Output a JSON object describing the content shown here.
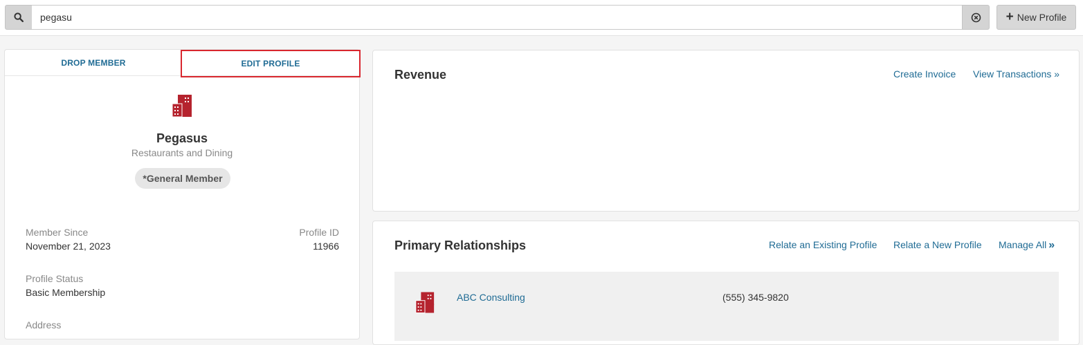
{
  "search": {
    "value": "pegasu",
    "new_profile_label": "New Profile"
  },
  "profile": {
    "tabs": {
      "drop_member": "DROP MEMBER",
      "edit_profile": "EDIT PROFILE"
    },
    "name": "Pegasus",
    "category": "Restaurants and Dining",
    "membership_badge": "*General Member",
    "member_since_label": "Member Since",
    "member_since_value": "November 21, 2023",
    "profile_id_label": "Profile ID",
    "profile_id_value": "11966",
    "status_label": "Profile Status",
    "status_value": "Basic Membership",
    "address_label": "Address"
  },
  "revenue": {
    "title": "Revenue",
    "create_invoice": "Create Invoice",
    "view_transactions": "View Transactions »"
  },
  "relationships": {
    "title": "Primary Relationships",
    "relate_existing": "Relate an Existing Profile",
    "relate_new": "Relate a New Profile",
    "manage_all": "Manage All",
    "items": [
      {
        "name": "ABC Consulting",
        "phone": "(555) 345-9820"
      }
    ]
  },
  "colors": {
    "link": "#1f6b94",
    "highlight": "#d9262e",
    "brand_icon": "#b5232e"
  },
  "icons": {
    "search": "search-icon",
    "clear": "clear-circle-icon",
    "plus": "plus-icon",
    "company": "building-icon",
    "chevron": "double-chevron-right-icon"
  }
}
